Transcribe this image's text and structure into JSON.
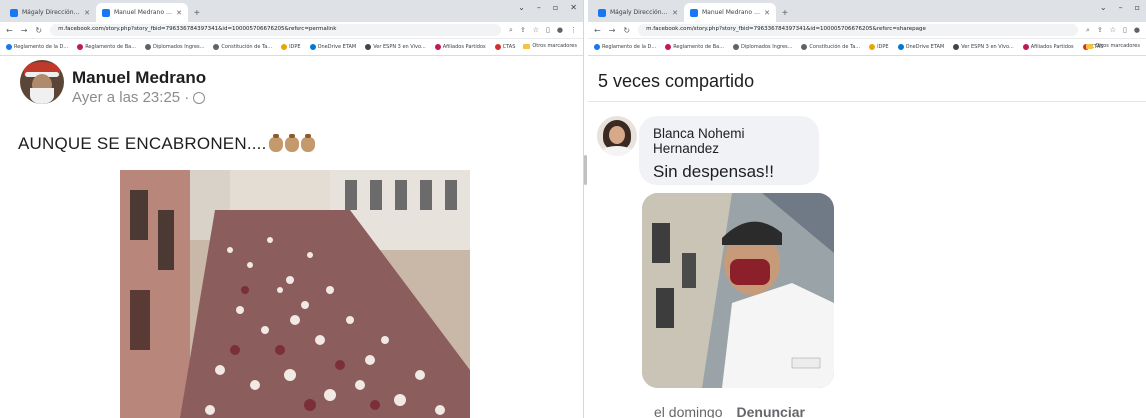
{
  "left_browser": {
    "tabs": [
      {
        "label": "Mágaly Dirección - Hay comentario",
        "active": false
      },
      {
        "label": "Manuel Medrano - AUNQUE SE ENC",
        "active": true
      }
    ],
    "url": "m.facebook.com/story.php?story_fbid=796336784397341&id=100005706676205&refsrc=permalink",
    "bookmarks": [
      "Reglamento de la D...",
      "Reglamento de Ba...",
      "Diplomados Ingres...",
      "Constitución de Ta...",
      "IDPE",
      "OneDrive ETAM",
      "Ver ESPN 3 en Vivo...",
      "Afiliados Partidos",
      "CTAS"
    ],
    "other_bookmarks": "Otros marcadores"
  },
  "right_browser": {
    "tabs": [
      {
        "label": "Mágaly Dirección - Hay comentario",
        "active": false
      },
      {
        "label": "Manuel Medrano - AUNQUE SE",
        "active": true
      }
    ],
    "url": "m.facebook.com/story.php?story_fbid=796336784397341&id=100005706676205&refsrc=sharepage",
    "bookmarks": [
      "Reglamento de la D...",
      "Reglamento de Ba...",
      "Diplomados Ingres...",
      "Constitución de Ta...",
      "IDPE",
      "OneDrive ETAM",
      "Ver ESPN 3 en Vivo...",
      "Afiliados Partidos",
      "CTAS"
    ],
    "other_bookmarks": "Otros marcadores"
  },
  "post": {
    "author": "Manuel Medrano",
    "time": "Ayer a las 23:25 ·",
    "text": "AUNQUE SE ENCABRONEN...."
  },
  "shares": {
    "count_text": "5 veces compartido"
  },
  "comment": {
    "author": "Blanca Nohemi Hernandez",
    "text": "Sin despensas!!",
    "time": "el domingo",
    "report_label": "Denunciar"
  },
  "colors": {
    "facebook_blue": "#1877f2",
    "secondary_text": "#8a8d91",
    "bubble_bg": "#f0f2f5"
  }
}
